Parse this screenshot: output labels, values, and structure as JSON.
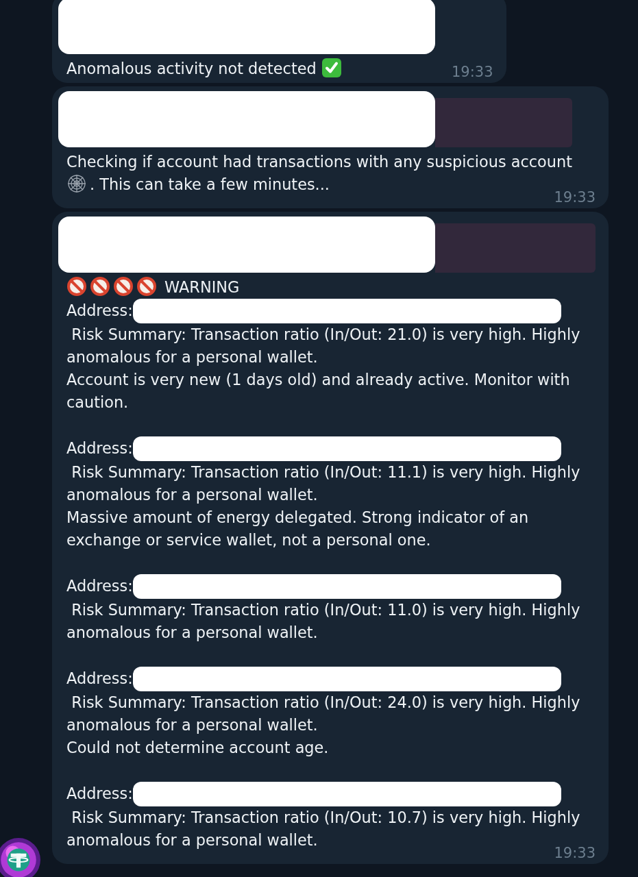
{
  "messages": [
    {
      "reply": {
        "redacted": true
      },
      "blocks": [
        {
          "kind": "line",
          "parts": [
            {
              "kind": "text",
              "text": "Anomalous activity not detected "
            },
            {
              "kind": "check"
            }
          ]
        }
      ],
      "time": "19:33"
    },
    {
      "reply": {
        "redacted": true
      },
      "blocks": [
        {
          "kind": "line",
          "parts": [
            {
              "kind": "text",
              "text": "Checking if account had transactions with any suspicious account"
            }
          ]
        },
        {
          "kind": "line",
          "parts": [
            {
              "kind": "web"
            },
            {
              "kind": "text",
              "text": ". This can take a few minutes..."
            }
          ]
        }
      ],
      "time": "19:33"
    },
    {
      "reply": {
        "redacted": true
      },
      "blocks": [
        {
          "kind": "line",
          "parts": [
            {
              "kind": "prohibited"
            },
            {
              "kind": "prohibited"
            },
            {
              "kind": "prohibited"
            },
            {
              "kind": "prohibited"
            },
            {
              "kind": "text",
              "text": " WARNING"
            }
          ]
        },
        {
          "kind": "address",
          "label": "Address:",
          "redacted": true
        },
        {
          "kind": "line",
          "parts": [
            {
              "kind": "text",
              "text": " Risk Summary: Transaction ratio (In/Out: 21.0) is very high. Highly anomalous for a personal wallet."
            }
          ]
        },
        {
          "kind": "line",
          "parts": [
            {
              "kind": "text",
              "text": "Account is very new (1 days old) and already active. Monitor with caution."
            }
          ]
        },
        {
          "kind": "gap"
        },
        {
          "kind": "address",
          "label": "Address:",
          "redacted": true
        },
        {
          "kind": "line",
          "parts": [
            {
              "kind": "text",
              "text": " Risk Summary: Transaction ratio (In/Out: 11.1) is very high. Highly anomalous for a personal wallet."
            }
          ]
        },
        {
          "kind": "line",
          "parts": [
            {
              "kind": "text",
              "text": "Massive amount of energy delegated. Strong indicator of an exchange or service wallet, not a personal one."
            }
          ]
        },
        {
          "kind": "gap"
        },
        {
          "kind": "address",
          "label": "Address:",
          "redacted": true
        },
        {
          "kind": "line",
          "parts": [
            {
              "kind": "text",
              "text": " Risk Summary: Transaction ratio (In/Out: 11.0) is very high. Highly anomalous for a personal wallet."
            }
          ]
        },
        {
          "kind": "gap"
        },
        {
          "kind": "address",
          "label": "Address:",
          "redacted": true
        },
        {
          "kind": "line",
          "parts": [
            {
              "kind": "text",
              "text": " Risk Summary: Transaction ratio (In/Out: 24.0) is very high. Highly anomalous for a personal wallet."
            }
          ]
        },
        {
          "kind": "line",
          "parts": [
            {
              "kind": "text",
              "text": "Could not determine account age."
            }
          ]
        },
        {
          "kind": "gap"
        },
        {
          "kind": "address",
          "label": "Address:",
          "redacted": true
        },
        {
          "kind": "line",
          "parts": [
            {
              "kind": "text",
              "text": " Risk Summary: Transaction ratio (In/Out: 10.7) is very high. Highly anomalous for a personal wallet."
            }
          ]
        }
      ],
      "time": "19:33"
    }
  ]
}
